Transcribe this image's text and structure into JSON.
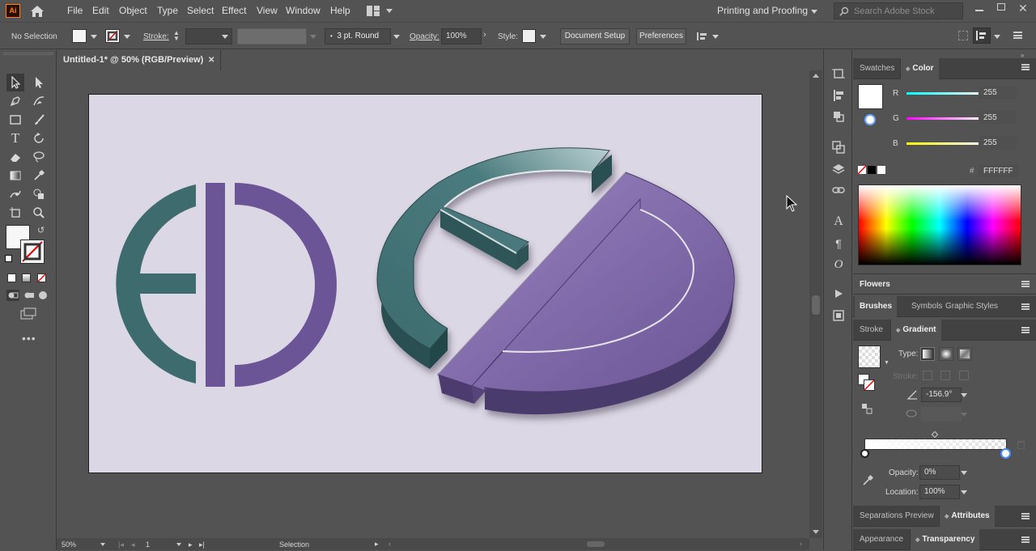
{
  "app": {
    "logo": "Ai",
    "workspace": "Printing and Proofing",
    "search_placeholder": "Search Adobe Stock"
  },
  "menu": [
    "File",
    "Edit",
    "Object",
    "Type",
    "Select",
    "Effect",
    "View",
    "Window",
    "Help"
  ],
  "control": {
    "selection": "No Selection",
    "stroke_label": "Stroke:",
    "brush": "3 pt. Round",
    "opacity_label": "Opacity:",
    "opacity": "100%",
    "style_label": "Style:",
    "document_setup": "Document Setup",
    "preferences": "Preferences"
  },
  "document": {
    "tab_title": "Untitled-1* @ 50% (RGB/Preview)"
  },
  "colors": {
    "teal": "#3d6b6e",
    "purple": "#6b5596",
    "artboard": "#dcd7e4"
  },
  "status": {
    "zoom": "50%",
    "artboard_num": "1",
    "tool": "Selection"
  },
  "panels": {
    "swatches_tab": "Swatches",
    "color_tab": "Color",
    "r_label": "R",
    "r_value": "255",
    "g_label": "G",
    "g_value": "255",
    "b_label": "B",
    "b_value": "255",
    "hex_label": "#",
    "hex_value": "FFFFFF",
    "flowers": "Flowers",
    "brushes": "Brushes",
    "symbols": "Symbols",
    "graphic_styles": "Graphic Styles",
    "stroke_tab": "Stroke",
    "gradient_tab": "Gradient",
    "type_label": "Type:",
    "stroke_label": "Stroke:",
    "angle": "-156.9°",
    "opacity_label": "Opacity:",
    "opacity_value": "0%",
    "location_label": "Location:",
    "location_value": "100%",
    "separations": "Separations Preview",
    "attributes": "Attributes",
    "appearance": "Appearance",
    "transparency": "Transparency"
  }
}
